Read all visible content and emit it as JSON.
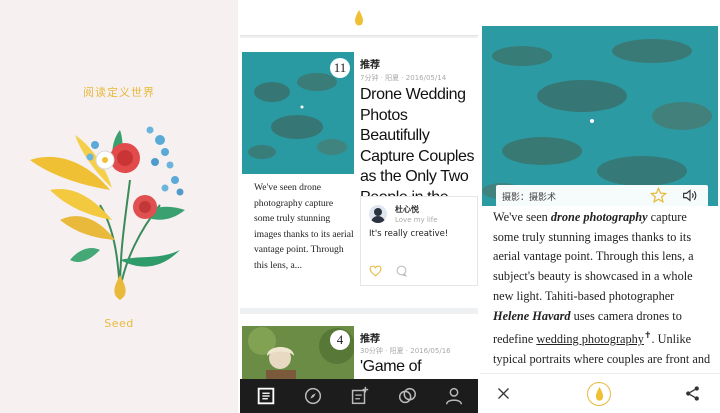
{
  "splash": {
    "slogan": "阅读定义世界",
    "brand": "Seed"
  },
  "feed": {
    "logo_icon": "drop-logo-icon",
    "cards": [
      {
        "rank": "11",
        "category": "推荐",
        "meta": "7分钟 · 阳夏    · 2016/05/14",
        "title": "Drone Wedding Photos Beautifully Capture Couples as the Only Two People in the World",
        "excerpt": "We've seen drone photography capture some truly stunning images thanks to its aerial vantage point. Through this lens, a...",
        "comment": {
          "user": "杜心悦",
          "tagline": "Love my life",
          "text": "It's really creative!"
        }
      },
      {
        "rank": "4",
        "category": "推荐",
        "meta": "30分钟 · 阳夏    · 2016/05/16",
        "title": "'Game of Thrones'"
      }
    ],
    "tabs": [
      "reader-icon",
      "compass-icon",
      "note-add-icon",
      "circles-icon",
      "person-icon"
    ]
  },
  "article": {
    "caption": "摄影：摄影术",
    "paragraph": {
      "t1": "We've seen ",
      "b1": "drone photography",
      "t2": " capture some truly stunning images thanks to its aerial vantage point. Through this lens, a subject's beauty is showcased in a whole new light. Tahiti-based photographer ",
      "b2": "Helene Havard",
      "t3": " uses camera drones to redefine ",
      "link": "wedding photography",
      "t4": ". Unlike typical portraits where couples are front and center,"
    }
  },
  "colors": {
    "accent": "#e9b93c",
    "tabbar": "#1c1c1c",
    "splash_bg": "#f7f0f1",
    "feed_bg": "#eef0f2"
  }
}
